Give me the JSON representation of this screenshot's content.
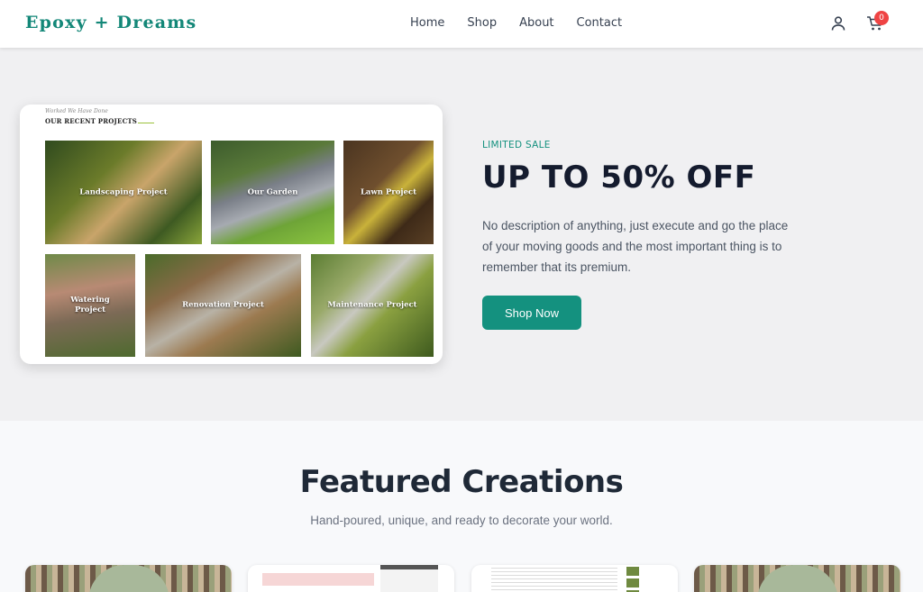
{
  "header": {
    "logo": "Epoxy + Dreams",
    "nav": [
      "Home",
      "Shop",
      "About",
      "Contact"
    ],
    "cart_count": "0"
  },
  "hero": {
    "projects_card": {
      "kicker": "Worked We Have Done",
      "heading": "OUR RECENT PROJECTS",
      "tiles": [
        "Landscaping Project",
        "Our Garden",
        "Lawn Project",
        "Watering Project",
        "Renovation Project",
        "Maintenance Project"
      ]
    },
    "sale_tag": "LIMITED SALE",
    "sale_title": "UP TO 50% OFF",
    "description": "No description of anything, just execute and go the place of your moving goods and the most important thing is to remember that its premium.",
    "cta": "Shop Now"
  },
  "featured": {
    "title": "Featured Creations",
    "subtitle": "Hand-poured, unique, and ready to decorate your world."
  },
  "colors": {
    "brand": "#138778",
    "accent": "#14917f",
    "badge": "#ef4444"
  },
  "icons": [
    "user-icon",
    "cart-icon"
  ]
}
